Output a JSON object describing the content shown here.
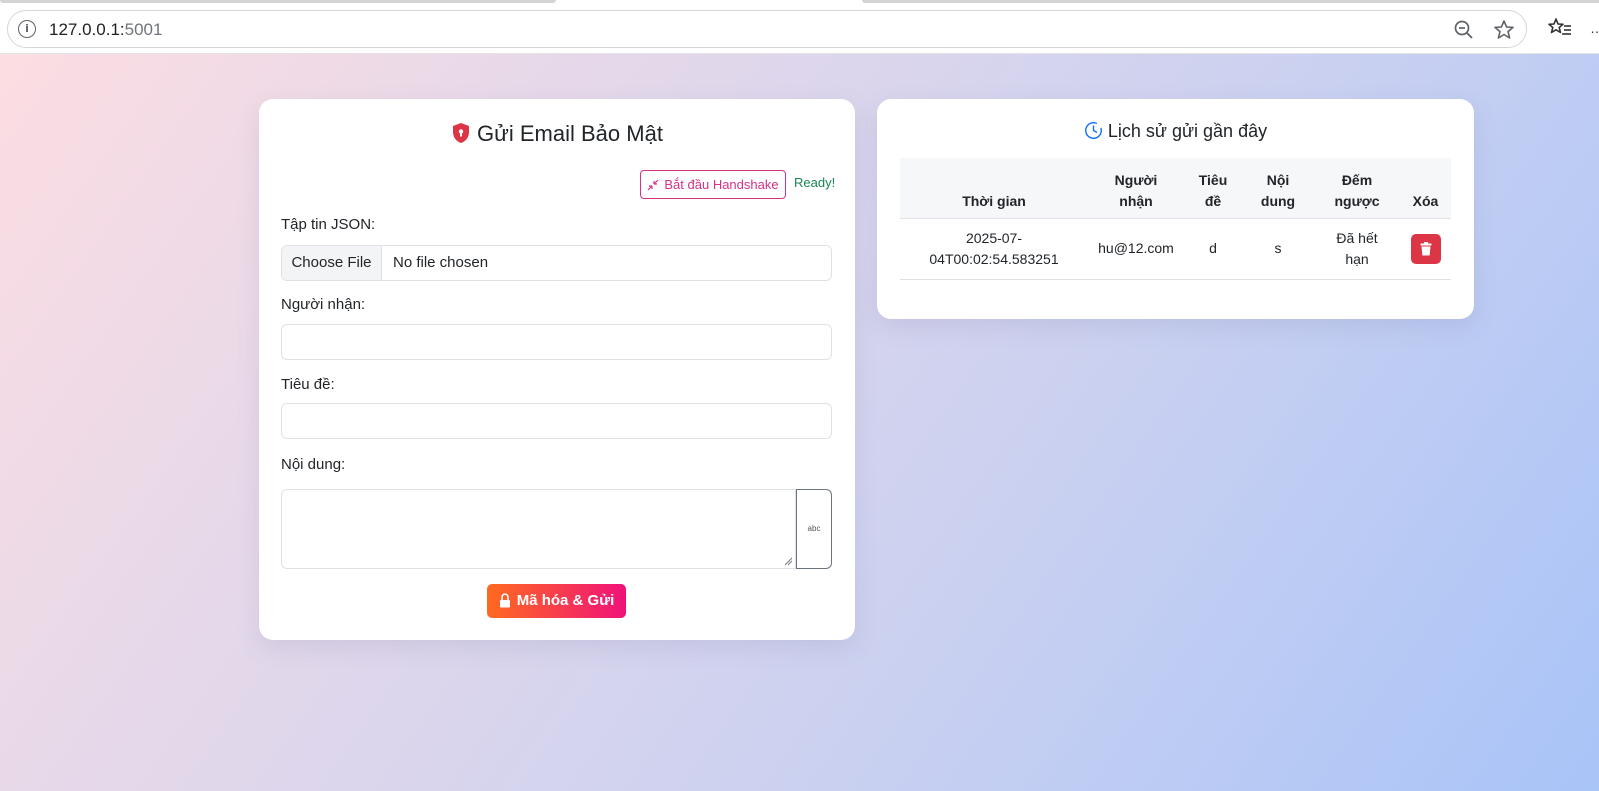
{
  "browser": {
    "url_host": "127.0.0.1:",
    "url_port": "5001"
  },
  "form": {
    "title": "Gửi Email Bảo Mật",
    "handshake_label": "Bắt đầu Handshake",
    "status": "Ready!",
    "json_label": "Tập tin JSON:",
    "file_button": "Choose File",
    "file_name": "No file chosen",
    "recipient_label": "Người nhận:",
    "recipient_value": "",
    "subject_label": "Tiêu đề:",
    "subject_value": "",
    "content_label": "Nội dung:",
    "content_value": "",
    "spell_label": "abc",
    "submit_label": "Mã hóa & Gửi"
  },
  "history": {
    "title": "Lịch sử gửi gần đây",
    "columns": {
      "time": "Thời gian",
      "recipient_1": "Người",
      "recipient_2": "nhận",
      "subject_1": "Tiêu",
      "subject_2": "đề",
      "content_1": "Nội",
      "content_2": "dung",
      "countdown_1": "Đếm",
      "countdown_2": "ngược",
      "delete": "Xóa"
    },
    "rows": [
      {
        "time_1": "2025-07-",
        "time_2": "04T00:02:54.583251",
        "recipient": "hu@12.com",
        "subject": "d",
        "content": "s",
        "countdown_1": "Đã hết",
        "countdown_2": "hạn"
      }
    ]
  },
  "colors": {
    "accent_pink": "#d63384",
    "ready_green": "#198754",
    "danger": "#dc3545",
    "shield_red": "#dc3545",
    "clock_blue": "#0d6efd"
  }
}
